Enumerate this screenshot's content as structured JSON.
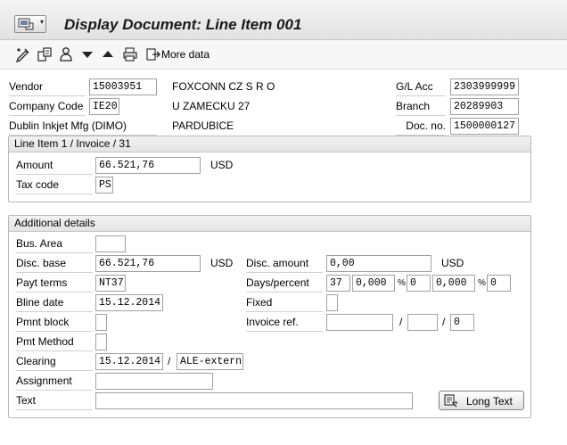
{
  "window": {
    "title": "Display Document: Line Item 001"
  },
  "toolbar": {
    "icons": [
      "edit-icon",
      "copy-icon",
      "person-icon",
      "arrow-down-icon",
      "arrow-up-icon",
      "print-icon"
    ],
    "more_data_label": "More data"
  },
  "header": {
    "vendor_label": "Vendor",
    "vendor_value": "15003951",
    "vendor_name": "FOXCONN CZ S R O",
    "gl_acc_label": "G/L Acc",
    "gl_acc_value": "2303999999",
    "company_code_label": "Company Code",
    "company_code_value": "IE20",
    "street": "U ZAMECKU 27",
    "branch_label": "Branch",
    "branch_value": "20289903",
    "company_name": "Dublin Inkjet Mfg (DIMO)",
    "city": "PARDUBICE",
    "doc_no_label": "Doc. no.",
    "doc_no_value": "1500000127"
  },
  "line_item": {
    "heading": "Line Item 1 / Invoice / 31",
    "amount_label": "Amount",
    "amount_value": "66.521,76",
    "amount_currency": "USD",
    "tax_code_label": "Tax code",
    "tax_code_value": "PS"
  },
  "details": {
    "heading": "Additional details",
    "bus_area_label": "Bus. Area",
    "bus_area_value": "",
    "disc_base_label": "Disc. base",
    "disc_base_value": "66.521,76",
    "disc_base_currency": "USD",
    "disc_amount_label": "Disc. amount",
    "disc_amount_value": "0,00",
    "disc_amount_currency": "USD",
    "payt_terms_label": "Payt terms",
    "payt_terms_value": "NT37",
    "days_percent_label": "Days/percent",
    "days1": "37",
    "pct1": "0,000",
    "days2": "0",
    "pct2": "0,000",
    "days3": "0",
    "percent_sign": "%",
    "bline_date_label": "Bline date",
    "bline_date_value": "15.12.2014",
    "fixed_label": "Fixed",
    "fixed_value": "",
    "pmnt_block_label": "Pmnt block",
    "pmnt_block_value": "",
    "invoice_ref_label": "Invoice ref.",
    "invoice_ref_value1": "",
    "invoice_ref_value2": "",
    "invoice_ref_value3": "0",
    "slash": "/",
    "pmt_method_label": "Pmt Method",
    "pmt_method_value": "",
    "clearing_label": "Clearing",
    "clearing_date": "15.12.2014",
    "clearing_doc": "ALE-extern",
    "assignment_label": "Assignment",
    "assignment_value": "",
    "text_label": "Text",
    "text_value": "",
    "long_text_label": "Long Text"
  }
}
